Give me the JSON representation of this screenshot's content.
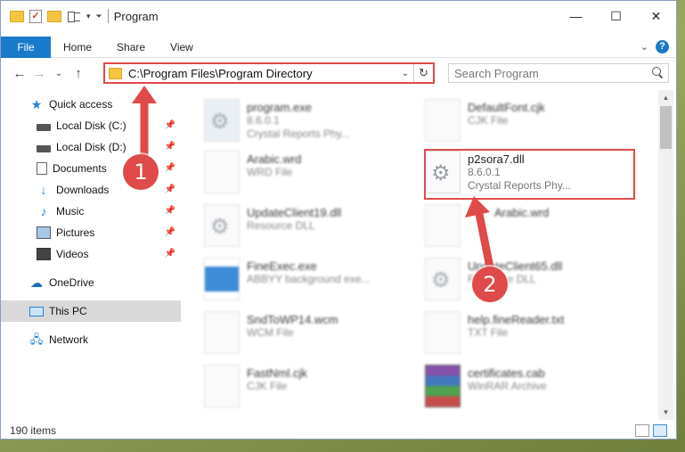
{
  "window": {
    "title": "Program"
  },
  "ribbon": {
    "file": "File",
    "tabs": [
      "Home",
      "Share",
      "View"
    ],
    "help": "?"
  },
  "nav": {
    "address": "C:\\Program Files\\Program Directory",
    "search_placeholder": "Search Program"
  },
  "sidebar": {
    "quick_access": "Quick access",
    "items": [
      "Local Disk (C:)",
      "Local Disk (D:)",
      "Documents",
      "Downloads",
      "Music",
      "Pictures",
      "Videos"
    ],
    "onedrive": "OneDrive",
    "this_pc": "This PC",
    "network": "Network"
  },
  "files": [
    {
      "name": "program.exe",
      "line2": "8.6.0.1",
      "line3": "Crystal Reports Phy..."
    },
    {
      "name": "DefaultFont.cjk",
      "line2": "CJK File",
      "line3": ""
    },
    {
      "name": "Arabic.wrd",
      "line2": "WRD File",
      "line3": ""
    },
    {
      "name": "p2sora7.dll",
      "line2": "8.6.0.1",
      "line3": "Crystal Reports Phy..."
    },
    {
      "name": "UpdateClient19.dll",
      "line2": "Resource DLL",
      "line3": ""
    },
    {
      "name": "Arabic.wrd",
      "line2": "",
      "line3": ""
    },
    {
      "name": "FineExec.exe",
      "line2": "ABBYY background exe...",
      "line3": ""
    },
    {
      "name": "UpdateClient65.dll",
      "line2": "Resource DLL",
      "line3": ""
    },
    {
      "name": "SndToWP14.wcm",
      "line2": "WCM File",
      "line3": ""
    },
    {
      "name": "help.fineReader.txt",
      "line2": "TXT File",
      "line3": ""
    },
    {
      "name": "FastNml.cjk",
      "line2": "CJK File",
      "line3": ""
    },
    {
      "name": "certificates.cab",
      "line2": "WinRAR Archive",
      "line3": ""
    }
  ],
  "status": {
    "items": "190 items"
  },
  "annotations": {
    "badge1": "1",
    "badge2": "2"
  },
  "colors": {
    "accent": "#1979ca",
    "highlight": "#e04a4a"
  }
}
